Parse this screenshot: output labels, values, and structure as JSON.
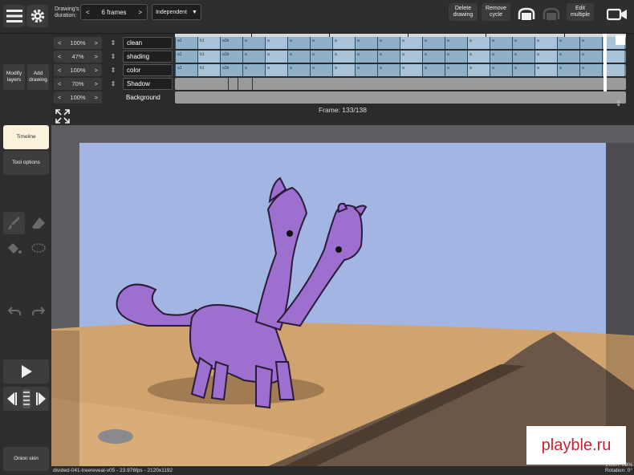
{
  "toolbar": {
    "duration_label": "Drawing's duration:",
    "duration_value": "6 frames",
    "prev": "<",
    "next": ">",
    "sync_mode": "Independent",
    "sync_arrow": "▼",
    "delete_drawing": "Delete drawing",
    "remove_cycle": "Remove cycle",
    "edit_multiple": "Edit multiple",
    "icons": [
      "menu-icon",
      "gear-icon",
      "onion-toggle-icon",
      "cycle-icon",
      "camera-icon"
    ]
  },
  "layers": [
    {
      "opacity": "100%",
      "name": "clean"
    },
    {
      "opacity": "47%",
      "name": "shading"
    },
    {
      "opacity": "100%",
      "name": "color"
    },
    {
      "opacity": "70%",
      "name": "Shadow"
    },
    {
      "opacity": "100%",
      "name": "Background"
    }
  ],
  "opacity_dec": "<",
  "opacity_inc": ">",
  "cell_labels": [
    "a1",
    "b1",
    "a1b",
    "a",
    "a",
    "a",
    "a",
    "a",
    "a",
    "a",
    "a",
    "a",
    "a",
    "a",
    "a",
    "a",
    "a",
    "a",
    "a",
    "a"
  ],
  "frame": {
    "label": "Frame: 133/138"
  },
  "sidebar": {
    "modify_layers": "Modify layers",
    "add_drawing": "Add drawing",
    "timeline": "Timeline",
    "tool_options": "Tool options",
    "onion_skin": "Onion skin"
  },
  "status": {
    "file_info": "divided-041-treereveal-v05 - 23.976fps - 2120x1192",
    "zoom": "Zoom: 88%",
    "rotation": "Rotation: 0°"
  },
  "watermark": "playble.ru",
  "colors": {
    "sky": "#a3b5e3",
    "ground": "#d1a46f",
    "character": "#9d6fcf",
    "accent_cell": "#8fb0c9"
  }
}
